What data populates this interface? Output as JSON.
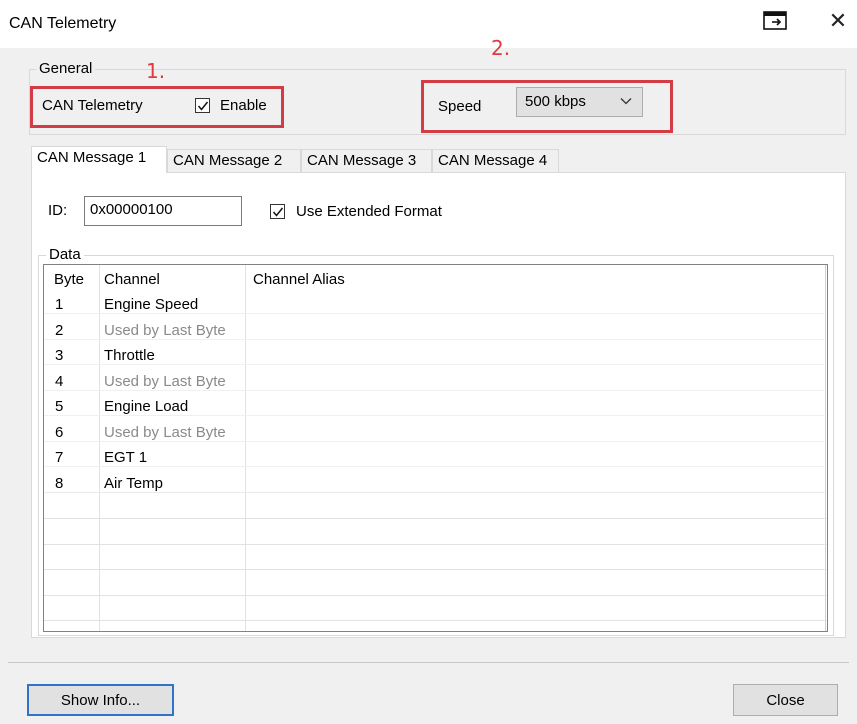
{
  "window": {
    "title": "CAN Telemetry"
  },
  "general": {
    "legend": "General",
    "can_telemetry_label": "CAN Telemetry",
    "enable_label": "Enable",
    "enable_checked": true,
    "speed_label": "Speed",
    "speed_value": "500 kbps"
  },
  "annotations": {
    "one": "1.",
    "two": "2.",
    "color": "#d23c44"
  },
  "tabs": [
    {
      "label": "CAN Message 1",
      "active": true
    },
    {
      "label": "CAN Message 2",
      "active": false
    },
    {
      "label": "CAN Message 3",
      "active": false
    },
    {
      "label": "CAN Message 4",
      "active": false
    }
  ],
  "message": {
    "id_label": "ID:",
    "id_value": "0x00000100",
    "extended_label": "Use Extended Format",
    "extended_checked": true
  },
  "data": {
    "legend": "Data",
    "headers": {
      "byte": "Byte",
      "channel": "Channel",
      "alias": "Channel Alias"
    },
    "rows": [
      {
        "byte": "1",
        "channel": "Engine Speed",
        "alias": "",
        "muted": false
      },
      {
        "byte": "2",
        "channel": "Used by Last Byte",
        "alias": "",
        "muted": true
      },
      {
        "byte": "3",
        "channel": "Throttle",
        "alias": "",
        "muted": false
      },
      {
        "byte": "4",
        "channel": "Used by Last Byte",
        "alias": "",
        "muted": true
      },
      {
        "byte": "5",
        "channel": "Engine Load",
        "alias": "",
        "muted": false
      },
      {
        "byte": "6",
        "channel": "Used by Last Byte",
        "alias": "",
        "muted": true
      },
      {
        "byte": "7",
        "channel": "EGT 1",
        "alias": "",
        "muted": false
      },
      {
        "byte": "8",
        "channel": "Air Temp",
        "alias": "",
        "muted": false
      }
    ]
  },
  "footer": {
    "show_info_label": "Show Info...",
    "close_label": "Close"
  },
  "icons": {
    "restore": "restore-window-icon",
    "close": "close-icon",
    "check": "check-icon",
    "dropdown": "chevron-down-icon"
  }
}
